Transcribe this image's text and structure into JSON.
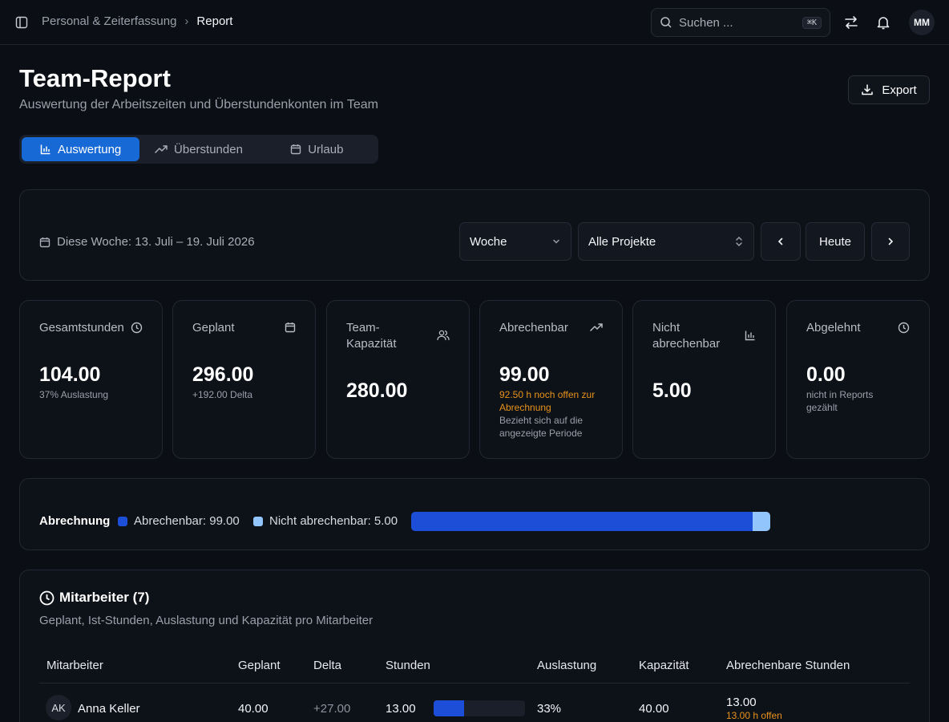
{
  "breadcrumb": {
    "parent": "Personal & Zeiterfassung",
    "separator": "›",
    "current": "Report"
  },
  "search": {
    "placeholder": "Suchen ...",
    "shortcut": "⌘K"
  },
  "user": {
    "initials": "MM"
  },
  "header": {
    "title": "Team-Report",
    "subtitle": "Auswertung der Arbeitszeiten und Überstundenkonten im Team",
    "export_label": "Export"
  },
  "tabs": [
    {
      "label": "Auswertung",
      "icon": "bar-chart-icon",
      "active": true
    },
    {
      "label": "Überstunden",
      "icon": "trending-up-icon",
      "active": false
    },
    {
      "label": "Urlaub",
      "icon": "calendar-icon",
      "active": false
    }
  ],
  "filters": {
    "period_label": "Diese Woche: 13. Juli – 19. Juli 2026",
    "range_select": "Woche",
    "project_select": "Alle Projekte",
    "today_label": "Heute"
  },
  "stats": [
    {
      "label": "Gesamtstunden",
      "icon": "clock-icon",
      "value": "104.00",
      "sub": "37% Auslastung"
    },
    {
      "label": "Geplant",
      "icon": "calendar-icon",
      "value": "296.00",
      "sub": "+192.00 Delta"
    },
    {
      "label": "Team-Kapazität",
      "icon": "users-icon",
      "value": "280.00"
    },
    {
      "label": "Abrechenbar",
      "icon": "trending-up-icon",
      "value": "99.00",
      "warning": "92.50 h noch offen zur Abrechnung",
      "sub": "Bezieht sich auf die angezeigte Periode"
    },
    {
      "label": "Nicht abrechenbar",
      "icon": "bar-chart-icon",
      "value": "5.00"
    },
    {
      "label": "Abgelehnt",
      "icon": "clock-icon",
      "value": "0.00",
      "sub": "nicht in Reports gezählt"
    }
  ],
  "billing": {
    "title": "Abrechnung",
    "billable_label": "Abrechenbar: 99.00",
    "non_billable_label": "Nicht abrechenbar: 5.00",
    "billable": 99.0,
    "non_billable": 5.0,
    "colors": {
      "billable": "#1d4ed8",
      "non_billable": "#93c5fd"
    }
  },
  "team": {
    "title": "Mitarbeiter (7)",
    "description": "Geplant, Ist-Stunden, Auslastung und Kapazität pro Mitarbeiter",
    "columns": [
      "Mitarbeiter",
      "Geplant",
      "Delta",
      "Stunden",
      "Auslastung",
      "Kapazität",
      "Abrechenbare Stunden"
    ],
    "rows": [
      {
        "initials": "AK",
        "name": "Anna Keller",
        "planned": "40.00",
        "delta": "+27.00",
        "hours": "13.00",
        "utilization_fraction": 0.33,
        "utilization": "33%",
        "capacity": "40.00",
        "billable": "13.00",
        "billable_open": "13.00 h offen"
      }
    ]
  }
}
